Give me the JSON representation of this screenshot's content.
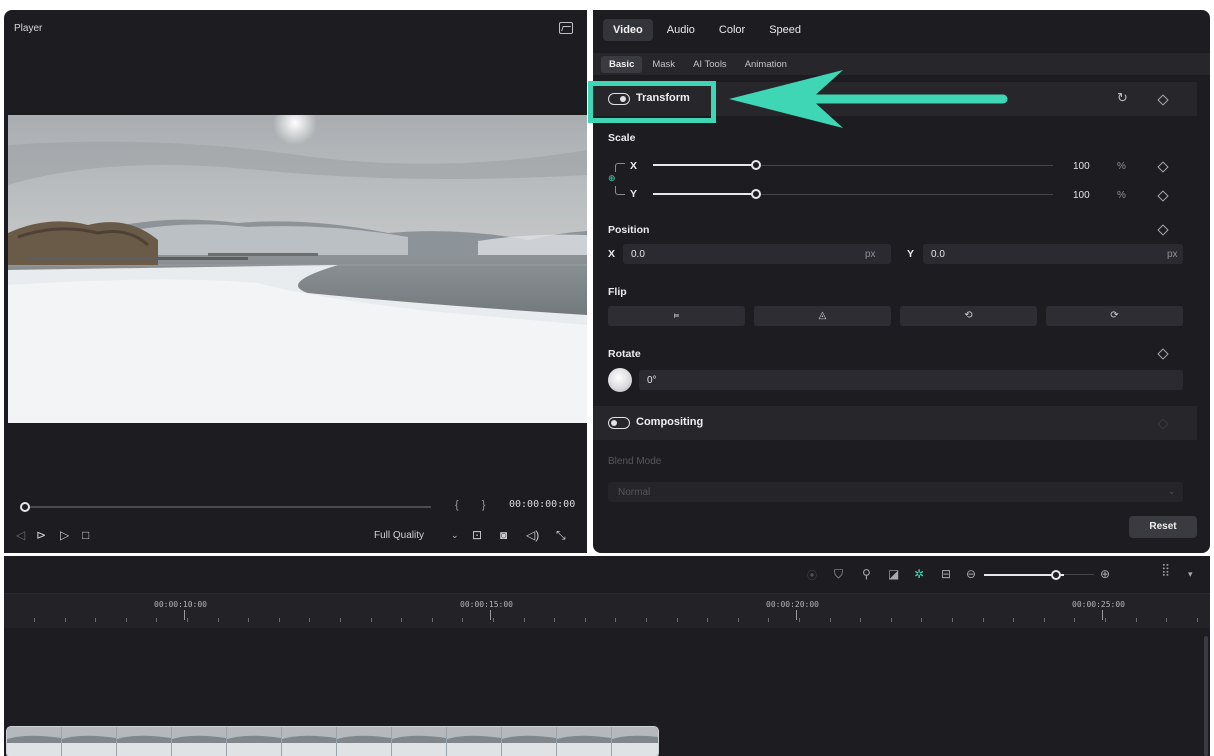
{
  "player": {
    "title": "Player",
    "timecode": "00:00:00:00",
    "braces": "{ }",
    "quality": "Full Quality",
    "progress": 0
  },
  "properties": {
    "tabs": [
      "Video",
      "Audio",
      "Color",
      "Speed"
    ],
    "active_tab": "Video",
    "subtabs": [
      "Basic",
      "Mask",
      "AI Tools",
      "Animation"
    ],
    "active_subtab": "Basic",
    "transform": {
      "label": "Transform",
      "enabled": true
    },
    "scale": {
      "label": "Scale",
      "x_label": "X",
      "x_value": "100",
      "x_unit": "%",
      "y_label": "Y",
      "y_value": "100",
      "y_unit": "%"
    },
    "position": {
      "label": "Position",
      "x_label": "X",
      "x_value": "0.0",
      "x_unit": "px",
      "y_label": "Y",
      "y_value": "0.0",
      "y_unit": "px"
    },
    "flip": {
      "label": "Flip"
    },
    "rotate": {
      "label": "Rotate",
      "value": "0°"
    },
    "compositing": {
      "label": "Compositing",
      "enabled": false
    },
    "blend_mode": {
      "label": "Blend Mode",
      "value": "Normal"
    },
    "reset_label": "Reset"
  },
  "timeline": {
    "ruler": [
      "00:00:10:00",
      "00:00:15:00",
      "00:00:20:00",
      "00:00:25:00"
    ]
  },
  "colors": {
    "annotation": "#3ed6b4",
    "panel_bg": "#1d1d21"
  }
}
